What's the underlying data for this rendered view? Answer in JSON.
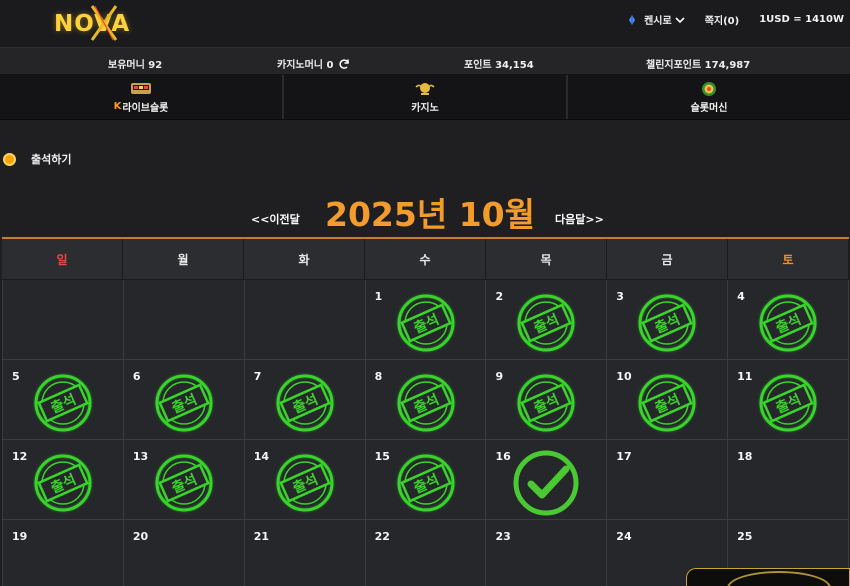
{
  "header": {
    "logo_text": "NOVA",
    "casino_selector": "켄시로",
    "messages": "쪽지(0)",
    "exchange_rate": "1USD = 1410W"
  },
  "balances": {
    "holding_money": "보유머니 92",
    "casino_money": "카지노머니 0",
    "points": "포인트 34,154",
    "challenge_points": "챌린지포인트 174,987"
  },
  "game_nav": [
    {
      "label": "라이브슬롯",
      "prefix": "K",
      "icon": "live-slot-icon"
    },
    {
      "label": "카지노",
      "icon": "casino-icon"
    },
    {
      "label": "슬롯머신",
      "icon": "slot-machine-icon"
    }
  ],
  "page": {
    "section_title": "출석하기",
    "prev_month": "<<이전달",
    "month_title": "2025년 10월",
    "next_month": "다음달>>"
  },
  "calendar": {
    "weekdays": [
      "일",
      "월",
      "화",
      "수",
      "목",
      "금",
      "토"
    ],
    "stamp_text": "출석",
    "weeks": [
      [
        {
          "day": "",
          "mark": ""
        },
        {
          "day": "",
          "mark": ""
        },
        {
          "day": "",
          "mark": ""
        },
        {
          "day": "1",
          "mark": "stamp"
        },
        {
          "day": "2",
          "mark": "stamp"
        },
        {
          "day": "3",
          "mark": "stamp"
        },
        {
          "day": "4",
          "mark": "stamp"
        }
      ],
      [
        {
          "day": "5",
          "mark": "stamp"
        },
        {
          "day": "6",
          "mark": "stamp"
        },
        {
          "day": "7",
          "mark": "stamp"
        },
        {
          "day": "8",
          "mark": "stamp"
        },
        {
          "day": "9",
          "mark": "stamp"
        },
        {
          "day": "10",
          "mark": "stamp"
        },
        {
          "day": "11",
          "mark": "stamp"
        }
      ],
      [
        {
          "day": "12",
          "mark": "stamp"
        },
        {
          "day": "13",
          "mark": "stamp"
        },
        {
          "day": "14",
          "mark": "stamp"
        },
        {
          "day": "15",
          "mark": "stamp"
        },
        {
          "day": "16",
          "mark": "check"
        },
        {
          "day": "17",
          "mark": ""
        },
        {
          "day": "18",
          "mark": ""
        }
      ],
      [
        {
          "day": "19",
          "mark": ""
        },
        {
          "day": "20",
          "mark": ""
        },
        {
          "day": "21",
          "mark": ""
        },
        {
          "day": "22",
          "mark": ""
        },
        {
          "day": "23",
          "mark": ""
        },
        {
          "day": "24",
          "mark": ""
        },
        {
          "day": "25",
          "mark": ""
        }
      ]
    ]
  },
  "colors": {
    "accent_orange": "#f39b2c",
    "stamp_green": "#35c928",
    "sunday_red": "#e94747",
    "saturday_orange": "#f08a2c"
  }
}
